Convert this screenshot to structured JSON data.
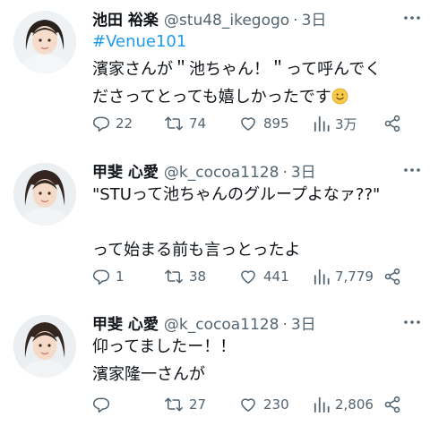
{
  "tweets": [
    {
      "name": "池田 裕楽",
      "handle": "@stu48_ikegogo",
      "separator": "·",
      "time": "3日",
      "hashtag": "#Venue101",
      "lines": [
        "濱家さんが＂池ちゃん！＂って呼んでく",
        "ださってとっても嬉しかったです"
      ],
      "emoji": "smiling-face",
      "replies": "22",
      "retweets": "74",
      "likes": "895",
      "views": "3万"
    },
    {
      "name": "甲斐 心愛",
      "handle": "@k_cocoa1128",
      "separator": "·",
      "time": "3日",
      "lines": [
        "\"STUって池ちゃんのグループよなァ??\"",
        "",
        "って始まる前も言っとったよ"
      ],
      "replies": "1",
      "retweets": "38",
      "likes": "441",
      "views": "7,779"
    },
    {
      "name": "甲斐 心愛",
      "handle": "@k_cocoa1128",
      "separator": "·",
      "time": "3日",
      "lines": [
        "仰ってましたー！！",
        "濱家隆一さんが"
      ],
      "replies": "",
      "retweets": "27",
      "likes": "230",
      "views": "2,806"
    }
  ],
  "colors": {
    "text": "#0f1419",
    "secondary": "#536471",
    "link": "#1d9bf0",
    "emoji": "#f7c948"
  }
}
